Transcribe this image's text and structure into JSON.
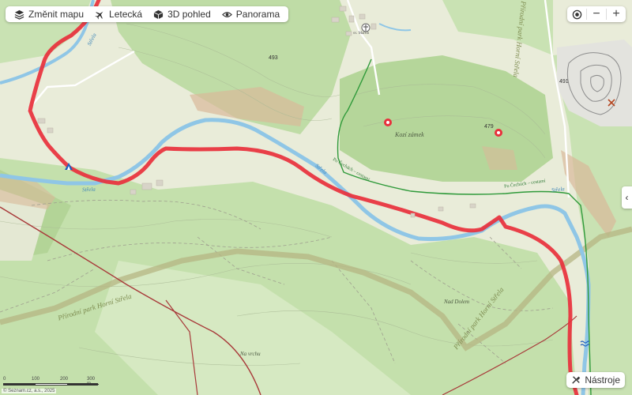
{
  "toolbar": {
    "change_map": "Změnit mapu",
    "aerial": "Letecká",
    "view_3d": "3D pohled",
    "panorama": "Panorama"
  },
  "zoom": {
    "in": "+",
    "out": "−"
  },
  "tools": {
    "label": "Nástroje"
  },
  "side_toggle": "‹",
  "copyright": "© Seznam.cz, a.s., 2025",
  "scale": {
    "labels": [
      "0",
      "100",
      "200",
      "300 m"
    ]
  },
  "labels": {
    "castle": "Kozí zámek",
    "park_left": "Přírodní park Horní Střela",
    "park_right": "Přírodní park Horní Střela",
    "park_top": "Přírodní park Horní Střela",
    "river_strela_1": "Střela",
    "river_strela_2": "Střela",
    "river_strela_3": "Střela",
    "river_strela_4": "Střela",
    "trail_1": "Po Čechách – cestami",
    "trail_2": "Po Čechách – cestami",
    "nad_dolem": "Nad Dolem",
    "na_vrchu": "Na vrchu",
    "martin": "sv. Martin",
    "peak_493": "493",
    "peak_479": "479",
    "peak_491": "491"
  },
  "colors": {
    "route": "#e8303c",
    "river": "#8fc6e6",
    "forest": "#bfdca6",
    "meadow": "#e9ecd9",
    "rock": "#d9b99a",
    "trail_green": "#2f9a3a",
    "boundary": "#a83a3a"
  }
}
